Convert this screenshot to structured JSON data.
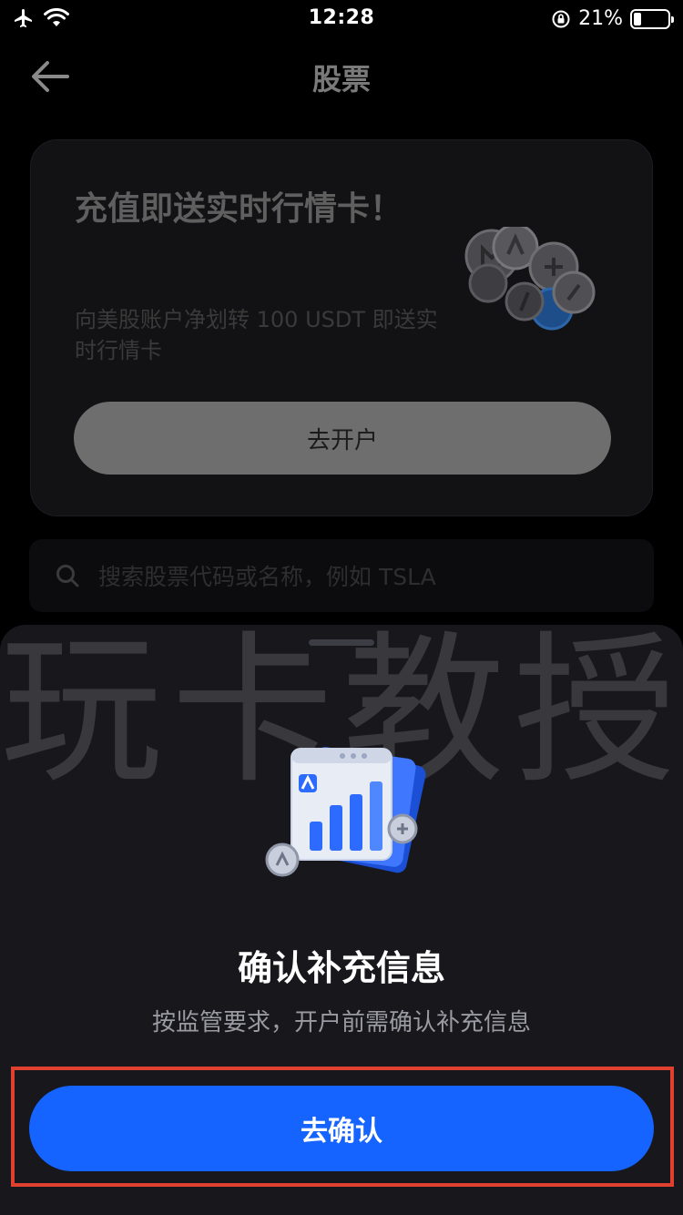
{
  "status_bar": {
    "time": "12:28",
    "battery_text": "21%",
    "battery_level": 0.21,
    "icons": [
      "airplane-icon",
      "wifi-icon",
      "rotation-lock-icon",
      "battery-icon"
    ]
  },
  "nav": {
    "title": "股票",
    "back_icon": "back-arrow-icon"
  },
  "promo": {
    "title": "充值即送实时行情卡！",
    "description": "向美股账户净划转 100 USDT 即送实时行情卡",
    "button_label": "去开户",
    "illustration": "coins-illustration"
  },
  "search": {
    "placeholder": "搜索股票代码或名称，例如 TSLA",
    "icon": "search-icon"
  },
  "sheet": {
    "watermark": "玩卡教授",
    "illustration": "stock-chart-illustration",
    "title": "确认补充信息",
    "subtitle": "按监管要求，开户前需确认补充信息",
    "confirm_label": "去确认"
  },
  "colors": {
    "primary_button": "#1664ff",
    "highlight_frame": "#e0402f",
    "sheet_background": "#17171c",
    "page_background": "#000000"
  }
}
